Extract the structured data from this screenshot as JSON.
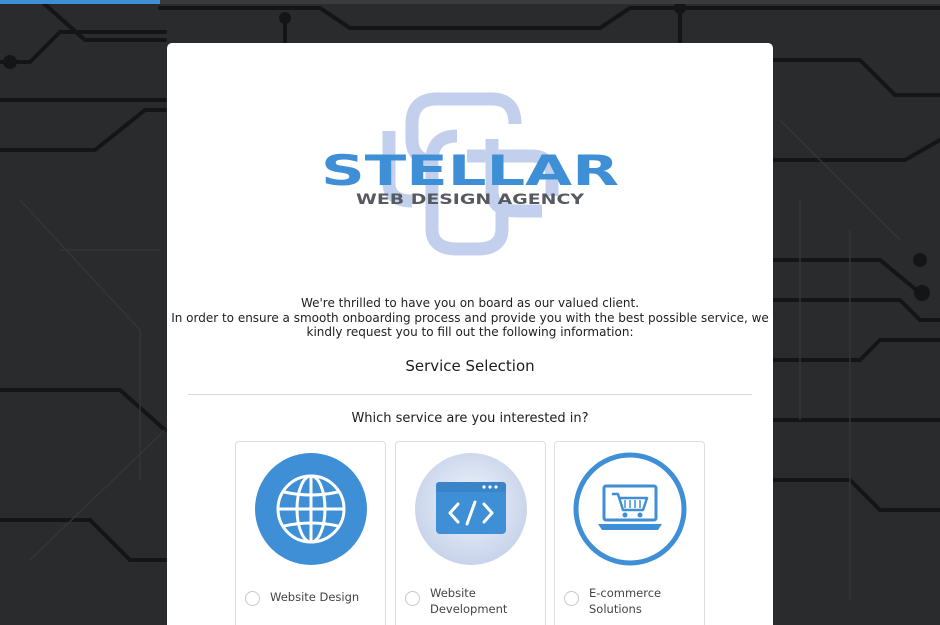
{
  "progress": {
    "fraction": 0.17
  },
  "brand": {
    "name": "STELLAR",
    "tagline": "WEB DESIGN AGENCY",
    "colors": {
      "primary": "#3f8fd6",
      "secondary": "#555a60",
      "light": "#b9c8ea"
    }
  },
  "intro": {
    "line1": "We're thrilled to have you on board as our valued client.",
    "line2": "In order to ensure a smooth onboarding process and provide you with the best possible service, we",
    "line3": "kindly request you to fill out the following information:"
  },
  "section": {
    "title": "Service Selection",
    "question": "Which service are you interested in?"
  },
  "options": [
    {
      "label": "Website Design",
      "icon": "globe-icon"
    },
    {
      "label_line1": "Website",
      "label_line2": "Development",
      "icon": "code-window-icon"
    },
    {
      "label_line1": "E-commerce",
      "label_line2": "Solutions",
      "icon": "shopping-cart-laptop-icon"
    }
  ]
}
